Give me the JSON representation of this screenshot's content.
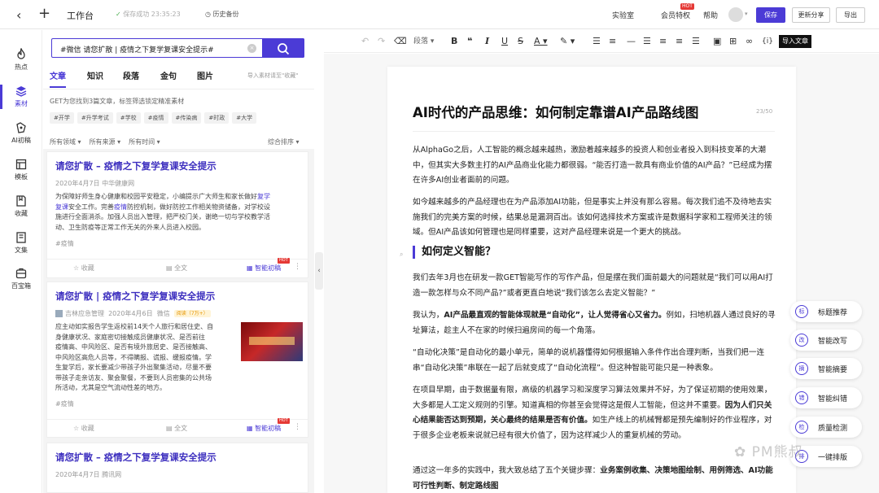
{
  "topbar": {
    "title": "工作台",
    "saved": "保存成功 23:35:23",
    "history": "历史备份",
    "lab": "实验室",
    "vip": "会员特权",
    "vip_badge": "HOT",
    "help": "帮助",
    "save": "保存",
    "share": "更新分享",
    "exit": "导出"
  },
  "rail": [
    {
      "label": "热点",
      "icon": "fire-icon"
    },
    {
      "label": "素材",
      "icon": "layers-icon"
    },
    {
      "label": "AI初稿",
      "icon": "ai-draft-icon"
    },
    {
      "label": "模板",
      "icon": "template-icon"
    },
    {
      "label": "收藏",
      "icon": "bookmark-icon"
    },
    {
      "label": "文集",
      "icon": "book-icon"
    },
    {
      "label": "百宝箱",
      "icon": "box-icon"
    }
  ],
  "panel": {
    "search_value": "#微信 请您扩散 | 疫情之下复学复课安全提示#",
    "tabs": [
      "文章",
      "知识",
      "段落",
      "金句",
      "图片"
    ],
    "import_hint": "导入素材请至\"收藏\"",
    "hint": "GET为您找到3篇文章，标签筛选锁定精准素材",
    "tags": [
      "#开学",
      "#升学考试",
      "#学校",
      "#疫情",
      "#传染病",
      "#时政",
      "#大学"
    ],
    "filters": [
      "所有领域 ▾",
      "所有来源 ▾",
      "所有时间 ▾"
    ],
    "sort": "综合排序 ▾",
    "cards": [
      {
        "title": "请您扩散 – 疫情之下复学复课安全提示",
        "meta": "2020年4月7日   中华健康网",
        "body_lines": [
          [
            "为保障好师生身心健康和校园平安稳定，小编提示广大师生和家长做好",
            "复学",
            ""
          ],
          [
            "复课",
            "安全工作。完善",
            "疫情",
            "防控机制，做好防控工作相关物资储备，对学校设"
          ],
          [
            "施进行全面消杀。加强人员出入管理，把严校门关，谢绝一切与学校教学活"
          ],
          [
            "动、卫生防疫等正常工作无关的外来人员进入校园。"
          ]
        ],
        "tag": "#疫情",
        "actions": [
          "收藏",
          "全文",
          "智能初稿"
        ]
      },
      {
        "title": "请您扩散 | 疫情之下复学复课安全提示",
        "source": "吉林应急管理",
        "date": "2020年4月6日",
        "channel": "微信",
        "reads": "阅读（7万+）",
        "body_lines": [
          "应主动如实报告学生返校前14天个人旅行和居住史、自",
          "身健康状况、家庭密切接触成员健康状况、是否前往",
          "疫情高、中风险区、是否有境外旅居史、是否接触高、",
          "中风险区高危人员等，不得瞒报、谎报、缓报疫情。学",
          "生复学后，家长要减少带孩子外出聚集活动，尽量不要",
          "带孩子走亲访友、聚会聚餐，不要到人员密集的公共场",
          "所活动，尤其是空气流动性差的地方。"
        ],
        "tag": "#疫情",
        "actions": [
          "收藏",
          "全文",
          "智能初稿"
        ]
      },
      {
        "title": "请您扩散 – 疫情之下复学复课安全提示",
        "meta": "2020年4月7日   腾讯网"
      }
    ]
  },
  "toolbar": {
    "paragraph": "段落",
    "import_tip": "导入文章"
  },
  "doc": {
    "title": "AI时代的产品思维：如何制定靠谱AI产品路线图",
    "title_count": "23/50",
    "p1": "从AlphaGo之后，人工智能的概念越来越热，激励着越来越多的投资人和创业者投入到科技变革的大潮中，但其实大多数主打的AI产品商业化能力都很弱。“能否打造一款具有商业价值的AI产品？”已经成为摆在许多AI创业者面前的问题。",
    "p2": "如今越来越多的产品经理也在为产品添加AI功能，但是事实上并没有那么容易。每次我们追不及待地去实施我们的完美方案的时候，结果总是漏洞百出。该如何选择技术方案或许是数据科学家和工程师关注的领域。但AI产品该如何管理也是同样重要，这对产品经理来说是一个更大的挑战。",
    "h2": "如何定义智能？",
    "p3": "我们去年3月也在研发一款GET智能写作的写作产品，但是摆在我们面前最大的问题就是“我们可以用AI打造一款怎样与众不同产品?”或者更直白地说“我们该怎么去定义智能？”",
    "p4a": "我认为，",
    "p4b": "AI产品最直观的智能体现就是“自动化”，让人觉得省心又省力。",
    "p4c": "例如，扫地机器人通过良好的寻址算法，趁主人不在家的时候扫遍房间的每一个角落。",
    "p5": "“自动化决策”是自动化的最小单元，简单的说机器懂得如何根据输入条件作出合理判断，当我们把一连串“自动化决策”串联在一起了后就变成了“自动化流程”。但这种智能可能只是一种表象。",
    "p6a": "在项目早期，由于数据量有限，高级的机器学习和深度学习算法效果并不好，为了保证初期的使用效果，大多都是人工定义规则的引擎。知道真相的你甚至会觉得这是假人工智能，但这并不重要。",
    "p6b": "因为人们只关心结果能否达到预期，关心最终的结果是否有价值。",
    "p6c": "如生产线上的机械臂都是预先编制好的作业程序，对于很多企业老板来说就已经有很大价值了，因为这样减少人的重复机械的劳动。",
    "p7a": "通过这一年多的实践中，我大致总结了五个关键步骤：",
    "p7b": "业务案例收集、决策地图绘制、用例筛选、AI功能可行性判断、制定路线图"
  },
  "side_tools": [
    {
      "label": "标题推荐",
      "icon": "标"
    },
    {
      "label": "智能改写",
      "icon": "改"
    },
    {
      "label": "智能摘要",
      "icon": "摘"
    },
    {
      "label": "智能纠错",
      "icon": "错"
    },
    {
      "label": "质量检测",
      "icon": "检"
    },
    {
      "label": "一键排版",
      "icon": "排"
    }
  ],
  "watermark": "PM熊叔",
  "colors": {
    "accent": "#4b3bd6",
    "hot": "#e53935"
  }
}
